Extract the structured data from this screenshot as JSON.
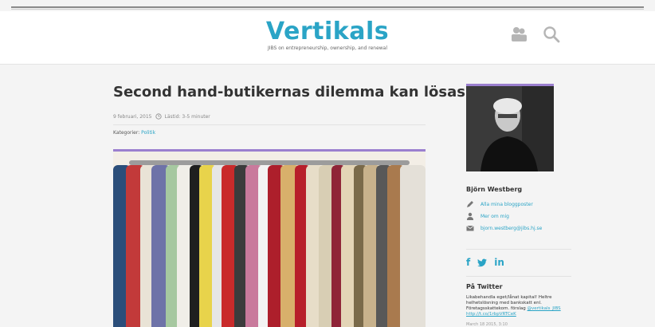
{
  "header": {
    "logo": "Vertikals",
    "tagline": "JIBS on entrepreneurship, ownership, and renewal"
  },
  "post": {
    "title": "Second hand-butikernas dilemma kan lösas!",
    "date": "9 februari, 2015",
    "read_time": "Lästid: 3-5 minuter",
    "categories_label": "Kategorier:",
    "category": "Politik"
  },
  "sidebar": {
    "author_name": "Björn Westberg",
    "links": [
      {
        "label": "Alla mina bloggposter",
        "icon": "pencil-icon"
      },
      {
        "label": "Mer om mig",
        "icon": "person-icon"
      },
      {
        "label": "bjorn.westberg@jibs.hj.se",
        "icon": "mail-icon"
      }
    ],
    "social": [
      "f",
      "y",
      "in"
    ],
    "twitter": {
      "heading": "På Twitter",
      "tweet_text": "Likabehandla eget/lånat kapital! Heltre helhetslösning med bankskatt enl. Företagsskattekom. förslag",
      "tweet_handle": "@vertikals_JIBS",
      "tweet_link": "http://t.co/1rbpVRTCeK",
      "tweet_date": "March 18 2015, 3:10"
    }
  },
  "colors": {
    "accent": "#2aa4c6",
    "purple_bar": "#9b7fcf"
  }
}
